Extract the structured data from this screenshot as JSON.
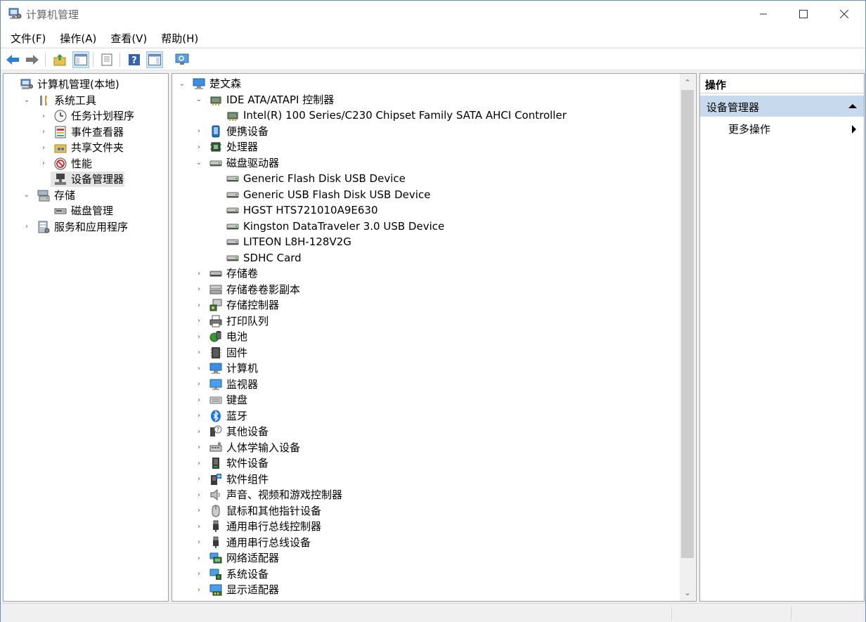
{
  "window": {
    "title": "计算机管理"
  },
  "menu": [
    "文件(F)",
    "操作(A)",
    "查看(V)",
    "帮助(H)"
  ],
  "toolbar": [
    "back-icon",
    "forward-icon",
    "up-folder-icon",
    "show-tree-icon",
    "properties-icon",
    "help-icon",
    "action-pane-icon",
    "monitor-icon"
  ],
  "left_tree": [
    {
      "label": "计算机管理(本地)",
      "icon": "computer-management-icon",
      "expand": "",
      "level": 0
    },
    {
      "label": "系统工具",
      "icon": "tools-icon",
      "expand": "⌄",
      "level": 1
    },
    {
      "label": "任务计划程序",
      "icon": "clock-icon",
      "expand": "›",
      "level": 2
    },
    {
      "label": "事件查看器",
      "icon": "event-viewer-icon",
      "expand": "›",
      "level": 2
    },
    {
      "label": "共享文件夹",
      "icon": "shared-folder-icon",
      "expand": "›",
      "level": 2
    },
    {
      "label": "性能",
      "icon": "performance-icon",
      "expand": "›",
      "level": 2
    },
    {
      "label": "设备管理器",
      "icon": "device-manager-icon",
      "expand": "",
      "level": 2,
      "selected": true
    },
    {
      "label": "存储",
      "icon": "storage-icon",
      "expand": "⌄",
      "level": 1
    },
    {
      "label": "磁盘管理",
      "icon": "disk-management-icon",
      "expand": "",
      "level": 2
    },
    {
      "label": "服务和应用程序",
      "icon": "services-icon",
      "expand": "›",
      "level": 1
    }
  ],
  "device_tree": [
    {
      "label": "楚文森",
      "icon": "computer-icon",
      "expand": "⌄",
      "level": 0
    },
    {
      "label": "IDE ATA/ATAPI 控制器",
      "icon": "ide-controller-icon",
      "expand": "⌄",
      "level": 1
    },
    {
      "label": "Intel(R) 100 Series/C230 Chipset Family SATA AHCI Controller",
      "icon": "ide-controller-icon",
      "expand": "",
      "level": 2
    },
    {
      "label": "便携设备",
      "icon": "portable-device-icon",
      "expand": "›",
      "level": 1
    },
    {
      "label": "处理器",
      "icon": "processor-icon",
      "expand": "›",
      "level": 1
    },
    {
      "label": "磁盘驱动器",
      "icon": "disk-drive-icon",
      "expand": "⌄",
      "level": 1
    },
    {
      "label": "Generic Flash Disk USB Device",
      "icon": "disk-drive-icon",
      "expand": "",
      "level": 2
    },
    {
      "label": "Generic USB Flash Disk USB Device",
      "icon": "disk-drive-icon",
      "expand": "",
      "level": 2
    },
    {
      "label": "HGST HTS721010A9E630",
      "icon": "disk-drive-icon",
      "expand": "",
      "level": 2
    },
    {
      "label": "Kingston DataTraveler 3.0 USB Device",
      "icon": "disk-drive-icon",
      "expand": "",
      "level": 2
    },
    {
      "label": "LITEON L8H-128V2G",
      "icon": "disk-drive-icon",
      "expand": "",
      "level": 2
    },
    {
      "label": "SDHC Card",
      "icon": "disk-drive-icon",
      "expand": "",
      "level": 2
    },
    {
      "label": "存储卷",
      "icon": "storage-volume-icon",
      "expand": "›",
      "level": 1
    },
    {
      "label": "存储卷卷影副本",
      "icon": "shadow-copy-icon",
      "expand": "›",
      "level": 1
    },
    {
      "label": "存储控制器",
      "icon": "storage-controller-icon",
      "expand": "›",
      "level": 1
    },
    {
      "label": "打印队列",
      "icon": "printer-icon",
      "expand": "›",
      "level": 1
    },
    {
      "label": "电池",
      "icon": "battery-icon",
      "expand": "›",
      "level": 1
    },
    {
      "label": "固件",
      "icon": "firmware-icon",
      "expand": "›",
      "level": 1
    },
    {
      "label": "计算机",
      "icon": "computer-icon",
      "expand": "›",
      "level": 1
    },
    {
      "label": "监视器",
      "icon": "monitor-icon",
      "expand": "›",
      "level": 1
    },
    {
      "label": "键盘",
      "icon": "keyboard-icon",
      "expand": "›",
      "level": 1
    },
    {
      "label": "蓝牙",
      "icon": "bluetooth-icon",
      "expand": "›",
      "level": 1
    },
    {
      "label": "其他设备",
      "icon": "other-devices-icon",
      "expand": "›",
      "level": 1
    },
    {
      "label": "人体学输入设备",
      "icon": "hid-icon",
      "expand": "›",
      "level": 1
    },
    {
      "label": "软件设备",
      "icon": "software-device-icon",
      "expand": "›",
      "level": 1
    },
    {
      "label": "软件组件",
      "icon": "software-component-icon",
      "expand": "›",
      "level": 1
    },
    {
      "label": "声音、视频和游戏控制器",
      "icon": "speaker-icon",
      "expand": "›",
      "level": 1
    },
    {
      "label": "鼠标和其他指针设备",
      "icon": "mouse-icon",
      "expand": "›",
      "level": 1
    },
    {
      "label": "通用串行总线控制器",
      "icon": "usb-icon",
      "expand": "›",
      "level": 1
    },
    {
      "label": "通用串行总线设备",
      "icon": "usb-icon",
      "expand": "›",
      "level": 1
    },
    {
      "label": "网络适配器",
      "icon": "network-adapter-icon",
      "expand": "›",
      "level": 1
    },
    {
      "label": "系统设备",
      "icon": "system-device-icon",
      "expand": "›",
      "level": 1
    },
    {
      "label": "显示适配器",
      "icon": "display-adapter-icon",
      "expand": "›",
      "level": 1
    }
  ],
  "actions": {
    "header": "操作",
    "section": "设备管理器",
    "more": "更多操作"
  }
}
